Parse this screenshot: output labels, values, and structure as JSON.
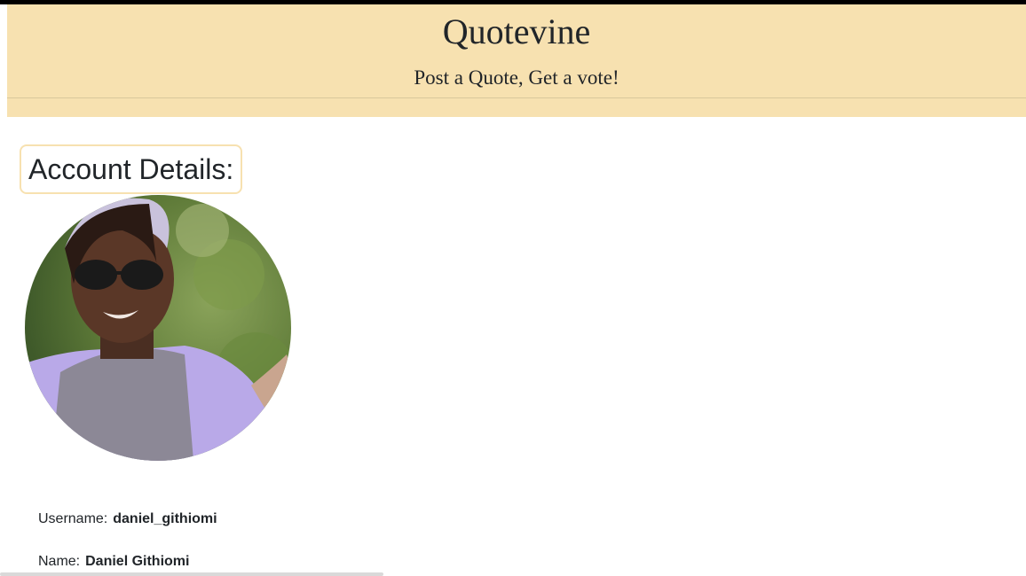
{
  "header": {
    "title": "Quotevine",
    "subtitle": "Post a Quote, Get a vote!"
  },
  "account": {
    "heading": "Account Details:",
    "avatar_icon": "profile-photo",
    "fields": [
      {
        "label": "Username:",
        "value": "daniel_githiomi"
      },
      {
        "label": "Name:",
        "value": "Daniel Githiomi"
      }
    ]
  },
  "colors": {
    "header_bg": "#f7e1b0",
    "top_bar": "#000000",
    "text": "#212529"
  }
}
